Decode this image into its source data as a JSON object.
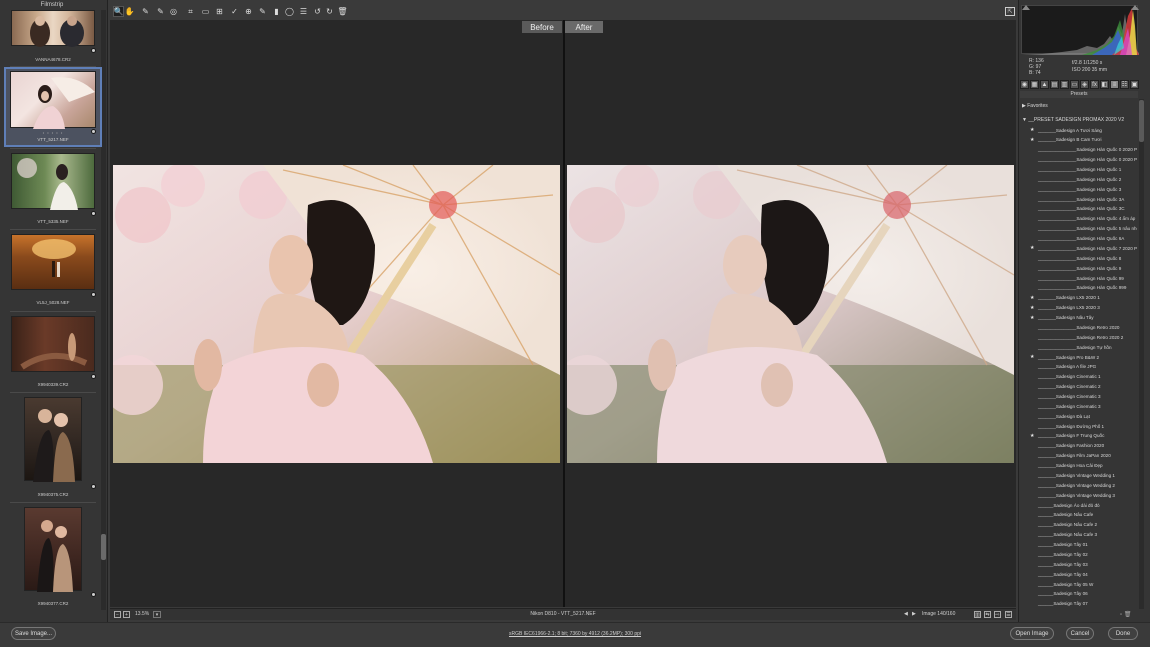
{
  "filmstrip": {
    "title": "Filmstrip",
    "items": [
      {
        "caption": "VANNA4678.CR2",
        "selected": false,
        "stars": ""
      },
      {
        "caption": "VTT_5217.NEF",
        "selected": true,
        "stars": "• • • • •"
      },
      {
        "caption": "VTT_5335.NEF",
        "selected": false,
        "stars": ""
      },
      {
        "caption": "VL5J_5028.NEF",
        "selected": false,
        "stars": ""
      },
      {
        "caption": "X9940339.CR2",
        "selected": false,
        "stars": ""
      },
      {
        "caption": "X9940375.CR2",
        "selected": false,
        "stars": ""
      },
      {
        "caption": "X9940377.CR2",
        "selected": false,
        "stars": ""
      }
    ]
  },
  "toolbar": {
    "tools": [
      {
        "icon": "zoom-icon",
        "glyph": "🔍",
        "active": true
      },
      {
        "icon": "hand-icon",
        "glyph": "✋",
        "active": false
      },
      {
        "icon": "white-balance-icon",
        "glyph": "✎",
        "active": false
      },
      {
        "icon": "color-sampler-icon",
        "glyph": "✎",
        "active": false
      },
      {
        "icon": "targeted-adjustment-icon",
        "glyph": "◎",
        "active": false
      },
      {
        "icon": "crop-icon",
        "glyph": "⌗",
        "active": false
      },
      {
        "icon": "straighten-icon",
        "glyph": "▭",
        "active": false
      },
      {
        "icon": "transform-icon",
        "glyph": "⊞",
        "active": false
      },
      {
        "icon": "spot-removal-icon",
        "glyph": "✓",
        "active": false
      },
      {
        "icon": "red-eye-icon",
        "glyph": "⊕",
        "active": false
      },
      {
        "icon": "adjustment-brush-icon",
        "glyph": "✎",
        "active": false
      },
      {
        "icon": "graduated-filter-icon",
        "glyph": "▮",
        "active": false
      },
      {
        "icon": "radial-filter-icon",
        "glyph": "◯",
        "active": false
      },
      {
        "icon": "preferences-icon",
        "glyph": "☰",
        "active": false
      },
      {
        "icon": "rotate-left-icon",
        "glyph": "↺",
        "active": false
      },
      {
        "icon": "rotate-right-icon",
        "glyph": "↻",
        "active": false
      },
      {
        "icon": "trash-icon",
        "glyph": "🗑",
        "active": false
      }
    ]
  },
  "preview": {
    "before_label": "Before",
    "after_label": "After"
  },
  "statusbar": {
    "zoom": "13.5%",
    "camera_file": "Nikon D810  -  VTT_5217.NEF",
    "image_counter": "Image 140/160"
  },
  "right_panel": {
    "rgb": {
      "r": "R:   136",
      "g": "G:     97",
      "b": "B:     74"
    },
    "exif": {
      "aperture_shutter": "f/2.8    1/1250 s",
      "iso_focal": "ISO 200    35 mm"
    },
    "presets_title": "Presets",
    "favorites_label": "Favorites",
    "group_label": "__PRESET SADESIGN PROMAX 2020 V2",
    "presets": [
      {
        "label": "_______Sadesign A Tươi Sáng",
        "star": true
      },
      {
        "label": "_______Sadesign B  Cam Tươi",
        "star": true
      },
      {
        "label": "_______________Sadesign Hàn Quốc 0 2020 Pro",
        "star": false
      },
      {
        "label": "_______________Sadesign Hàn Quốc 0 2020 Pro 2",
        "star": false
      },
      {
        "label": "_______________Sadesign Hàn Quốc 1",
        "star": false
      },
      {
        "label": "_______________Sadesign Hàn Quốc 2",
        "star": false
      },
      {
        "label": "_______________Sadesign Hàn Quốc 3",
        "star": false
      },
      {
        "label": "_______________Sadesign Hàn Quốc 3A",
        "star": false
      },
      {
        "label": "_______________Sadesign Hàn Quốc 3C",
        "star": false
      },
      {
        "label": "_______________Sadesign Hàn Quốc 4 ẩm áp",
        "star": false
      },
      {
        "label": "_______________Sadesign Hàn Quốc 5 nâu nhẹ",
        "star": false
      },
      {
        "label": "_______________Sadesign Hàn Quốc 6A",
        "star": false
      },
      {
        "label": "_______________Sadesign Hàn Quốc 7 2020 Pro 2",
        "star": true
      },
      {
        "label": "_______________Sadesign Hàn Quốc 8",
        "star": false
      },
      {
        "label": "_______________Sadesign Hàn Quốc 9",
        "star": false
      },
      {
        "label": "_______________Sadesign Hàn Quốc 99",
        "star": false
      },
      {
        "label": "_______________Sadesign Hàn Quốc 999",
        "star": false
      },
      {
        "label": "_______Sadesign LX5 2020 1",
        "star": true
      },
      {
        "label": "_______Sadesign LX5 2020 3",
        "star": true
      },
      {
        "label": "_______Sadesign Nâu Tây",
        "star": true
      },
      {
        "label": "_______________Sadesign Retro 2020",
        "star": false
      },
      {
        "label": "_______________Sadesign Retro 2020 2",
        "star": false
      },
      {
        "label": "_______________Sadesign Tự hồn",
        "star": false
      },
      {
        "label": "_______Sadesign  Pro B&W 2",
        "star": true
      },
      {
        "label": "_______Sadesign A file JPG",
        "star": false
      },
      {
        "label": "_______Sadesign Cinematic 1",
        "star": false
      },
      {
        "label": "_______Sadesign Cinematic 2",
        "star": false
      },
      {
        "label": "_______Sadesign Cinematic 3",
        "star": false
      },
      {
        "label": "_______Sadesign Cinematic 3",
        "star": false
      },
      {
        "label": "_______Sadesign Đà Lạt",
        "star": false
      },
      {
        "label": "_______Sadesign Đường Phố 1",
        "star": false
      },
      {
        "label": "_______Sadesign F Trung Quốc",
        "star": true
      },
      {
        "label": "_______Sadesign Fashion 2020",
        "star": false
      },
      {
        "label": "_______Sadesign Film JaPan 2020",
        "star": false
      },
      {
        "label": "_______Sadesign Hoa Cải Đẹp",
        "star": false
      },
      {
        "label": "_______Sadesign Vintage Wedding 1",
        "star": false
      },
      {
        "label": "_______Sadesign Vintage Wedding 2",
        "star": false
      },
      {
        "label": "_______Sadesign Vintage Wedding 3",
        "star": false
      },
      {
        "label": "______Sadesign Áo dài đỏ đỏ",
        "star": false
      },
      {
        "label": "______Sadesign Nâu Cafe",
        "star": false
      },
      {
        "label": "______Sadesign Nâu Cafe 2",
        "star": false
      },
      {
        "label": "______Sadesign Nâu Cafe 3",
        "star": false
      },
      {
        "label": "______Sadesign Tây 01",
        "star": false
      },
      {
        "label": "______Sadesign Tây 02",
        "star": false
      },
      {
        "label": "______Sadesign Tây 03",
        "star": false
      },
      {
        "label": "______Sadesign Tây 04",
        "star": false
      },
      {
        "label": "______Sadesign Tây 05 W",
        "star": false
      },
      {
        "label": "______Sadesign Tây 06",
        "star": false
      },
      {
        "label": "______Sadesign Tây 07",
        "star": false
      }
    ]
  },
  "bottom_bar": {
    "save_label": "Save Image...",
    "workflow_link": "sRGB IEC61966-2.1; 8 bit; 7360 by 4912 (36.2MP); 300 ppi",
    "open_label": "Open Image",
    "cancel_label": "Cancel",
    "done_label": "Done"
  },
  "colors": {
    "accent": "#5f7fb8",
    "panel_bg": "#353535",
    "preview_bg": "#282828"
  }
}
